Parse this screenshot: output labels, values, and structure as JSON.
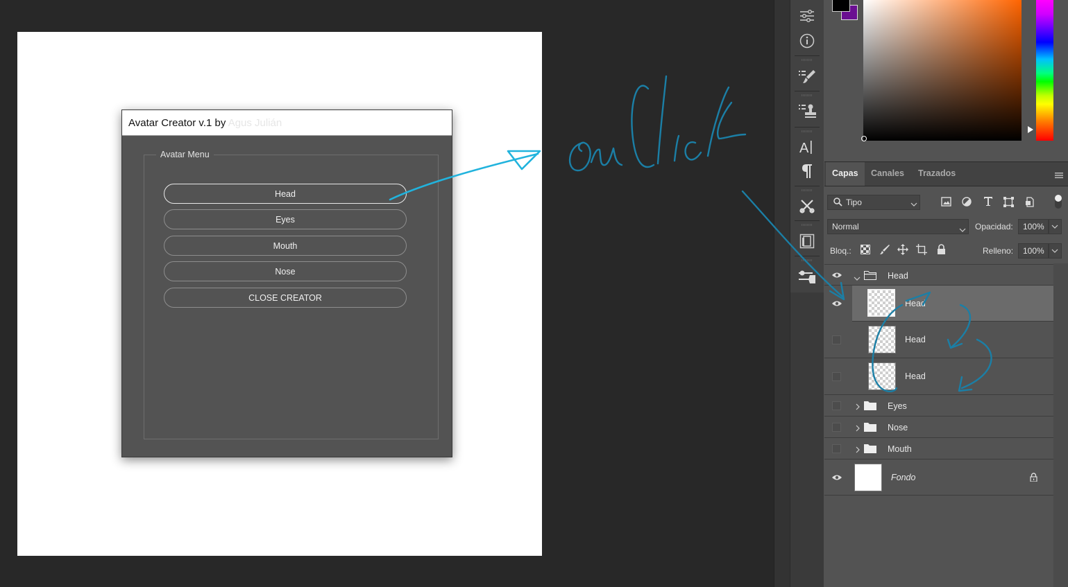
{
  "dialog": {
    "title": "Avatar Creator v.1 by",
    "title_author_faded": "Agus Julián",
    "group_label": "Avatar Menu",
    "buttons": [
      "Head",
      "Eyes",
      "Mouth",
      "Nose",
      "CLOSE CREATOR"
    ]
  },
  "annotation": {
    "handwritten_text": "on Click",
    "color": "#1b7fa6"
  },
  "tools": [
    "properties-icon",
    "info-icon",
    "brush-presets-icon",
    "clone-source-icon",
    "character-icon",
    "paragraph-icon",
    "tool-presets-icon",
    "navigator-icon",
    "adjustments-icon"
  ],
  "colors": {
    "foreground": "#000000",
    "background": "#6a0f91"
  },
  "layers_panel": {
    "tabs": [
      "Capas",
      "Canales",
      "Trazados"
    ],
    "filter_label": "Tipo",
    "blend_mode": "Normal",
    "opacity_label": "Opacidad:",
    "opacity_value": "100%",
    "lock_label": "Bloq.:",
    "fill_label": "Relleno:",
    "fill_value": "100%",
    "layers": [
      {
        "name": "Head",
        "type": "group",
        "visible": true,
        "expanded": true
      },
      {
        "name": "Head",
        "type": "layer",
        "visible": true,
        "selected": true
      },
      {
        "name": "Head",
        "type": "layer",
        "visible": false
      },
      {
        "name": "Head",
        "type": "layer",
        "visible": false
      },
      {
        "name": "Eyes",
        "type": "group",
        "visible": false
      },
      {
        "name": "Nose",
        "type": "group",
        "visible": false
      },
      {
        "name": "Mouth",
        "type": "group",
        "visible": false
      },
      {
        "name": "Fondo",
        "type": "background",
        "visible": true,
        "locked": true
      }
    ]
  }
}
